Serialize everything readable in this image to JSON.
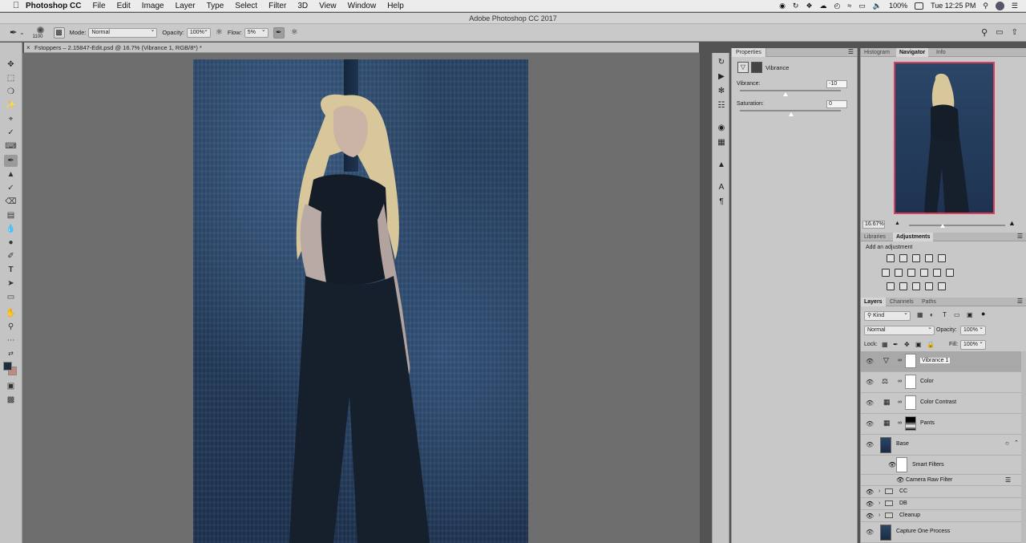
{
  "menubar": {
    "app_name": "Photoshop CC",
    "items": [
      "File",
      "Edit",
      "Image",
      "Layer",
      "Type",
      "Select",
      "Filter",
      "3D",
      "View",
      "Window",
      "Help"
    ],
    "battery": "100%",
    "clock": "Tue 12:25 PM"
  },
  "window_title": "Adobe Photoshop CC 2017",
  "options_bar": {
    "brush_size": "1100",
    "mode_label": "Mode:",
    "mode_value": "Normal",
    "opacity_label": "Opacity:",
    "opacity_value": "100%",
    "flow_label": "Flow:",
    "flow_value": "5%"
  },
  "document_tab": "Fstoppers – 2.15847-Edit.psd @ 16.7% (Vibrance 1, RGB/8*) *",
  "properties": {
    "tab": "Properties",
    "title": "Vibrance",
    "vibrance_label": "Vibrance:",
    "vibrance_value": "-10",
    "saturation_label": "Saturation:",
    "saturation_value": "0"
  },
  "navigator": {
    "tabs": [
      "Histogram",
      "Navigator",
      "Info"
    ],
    "zoom": "16.67%"
  },
  "adjustments": {
    "tabs": [
      "Libraries",
      "Adjustments"
    ],
    "hint": "Add an adjustment"
  },
  "layers_panel": {
    "tabs": [
      "Layers",
      "Channels",
      "Paths"
    ],
    "filter_kind": "Kind",
    "blend_mode": "Normal",
    "opacity_label": "Opacity:",
    "opacity_value": "100%",
    "lock_label": "Lock:",
    "fill_label": "Fill:",
    "fill_value": "100%",
    "layers": [
      {
        "name": "Vibrance 1"
      },
      {
        "name": "Color"
      },
      {
        "name": "Color Contrast"
      },
      {
        "name": "Pants"
      },
      {
        "name": "Base"
      }
    ],
    "smart_filters_label": "Smart Filters",
    "camera_raw_label": "Camera Raw Filter",
    "groups": [
      "CC",
      "DB",
      "Cleanup"
    ],
    "bottom_layer": "Capture One Process"
  },
  "colors": {
    "ui_panel": "#c8c8c8",
    "canvas_bg": "#6e6e6e",
    "photo_blue": "#2a4566",
    "navigator_frame": "#d8405a"
  }
}
